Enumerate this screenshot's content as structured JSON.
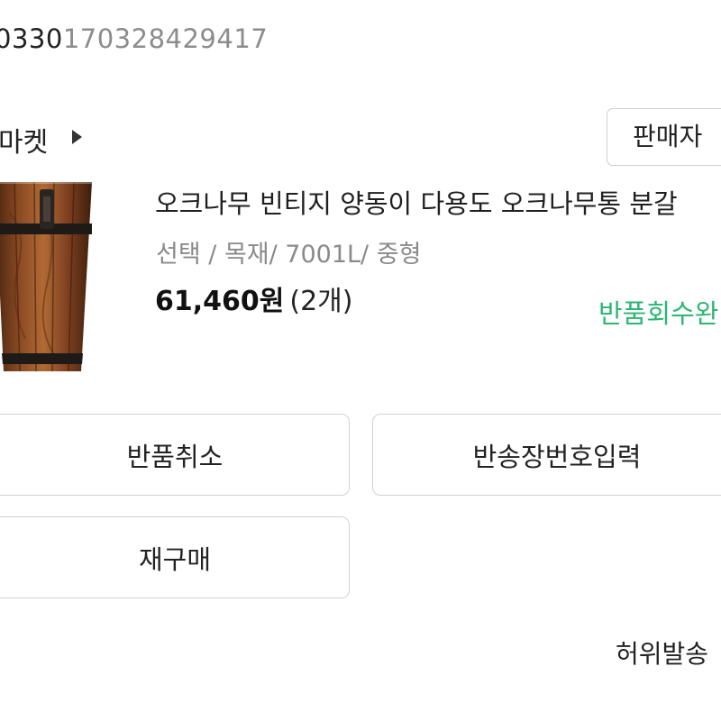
{
  "order": {
    "number_visible": "0330",
    "number_muted": "170328429417"
  },
  "seller": {
    "name": "마켓",
    "seller_button": "판매자"
  },
  "product": {
    "image_icon": "wooden-oak-bucket-image",
    "title": "오크나무 빈티지 양동이 다용도 오크나무통 분갈",
    "option": "선택 / 목재/ 7001L/ 중형",
    "price": "61,460원",
    "quantity": "(2개)",
    "return_status": "반품회수완"
  },
  "actions": {
    "cancel_return": "반품취소",
    "enter_tracking": "반송장번호입력",
    "rebuy": "재구매"
  },
  "footer": {
    "fake_shipping": "허위발송"
  },
  "colors": {
    "accent_green": "#2bb673",
    "muted_text": "#8c8c8c",
    "border": "#d2d2d2"
  }
}
